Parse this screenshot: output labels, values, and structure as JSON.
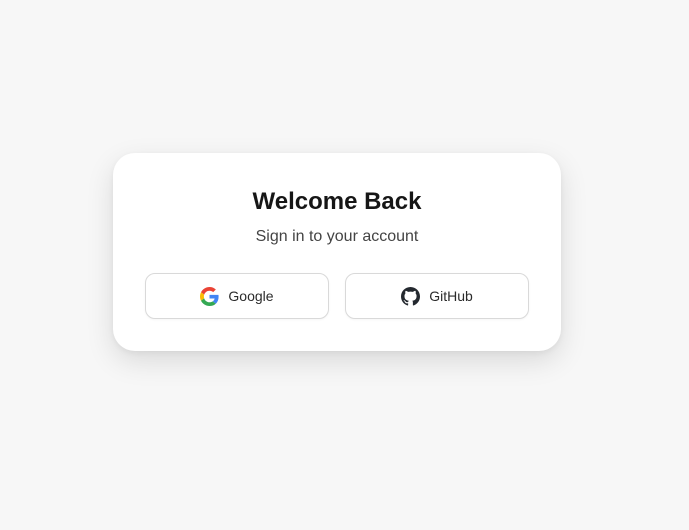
{
  "card": {
    "title": "Welcome Back",
    "subtitle": "Sign in to your account"
  },
  "buttons": [
    {
      "label": "Google",
      "icon": "google-icon"
    },
    {
      "label": "GitHub",
      "icon": "github-icon"
    }
  ],
  "colors": {
    "background": "#f7f7f7",
    "card": "#ffffff",
    "title": "#161616",
    "subtitle": "#444444",
    "button_border": "#d9d9d9",
    "google_blue": "#4285F4",
    "google_red": "#EA4335",
    "google_yellow": "#FBBC05",
    "google_green": "#34A853",
    "github_dark": "#24292f"
  }
}
